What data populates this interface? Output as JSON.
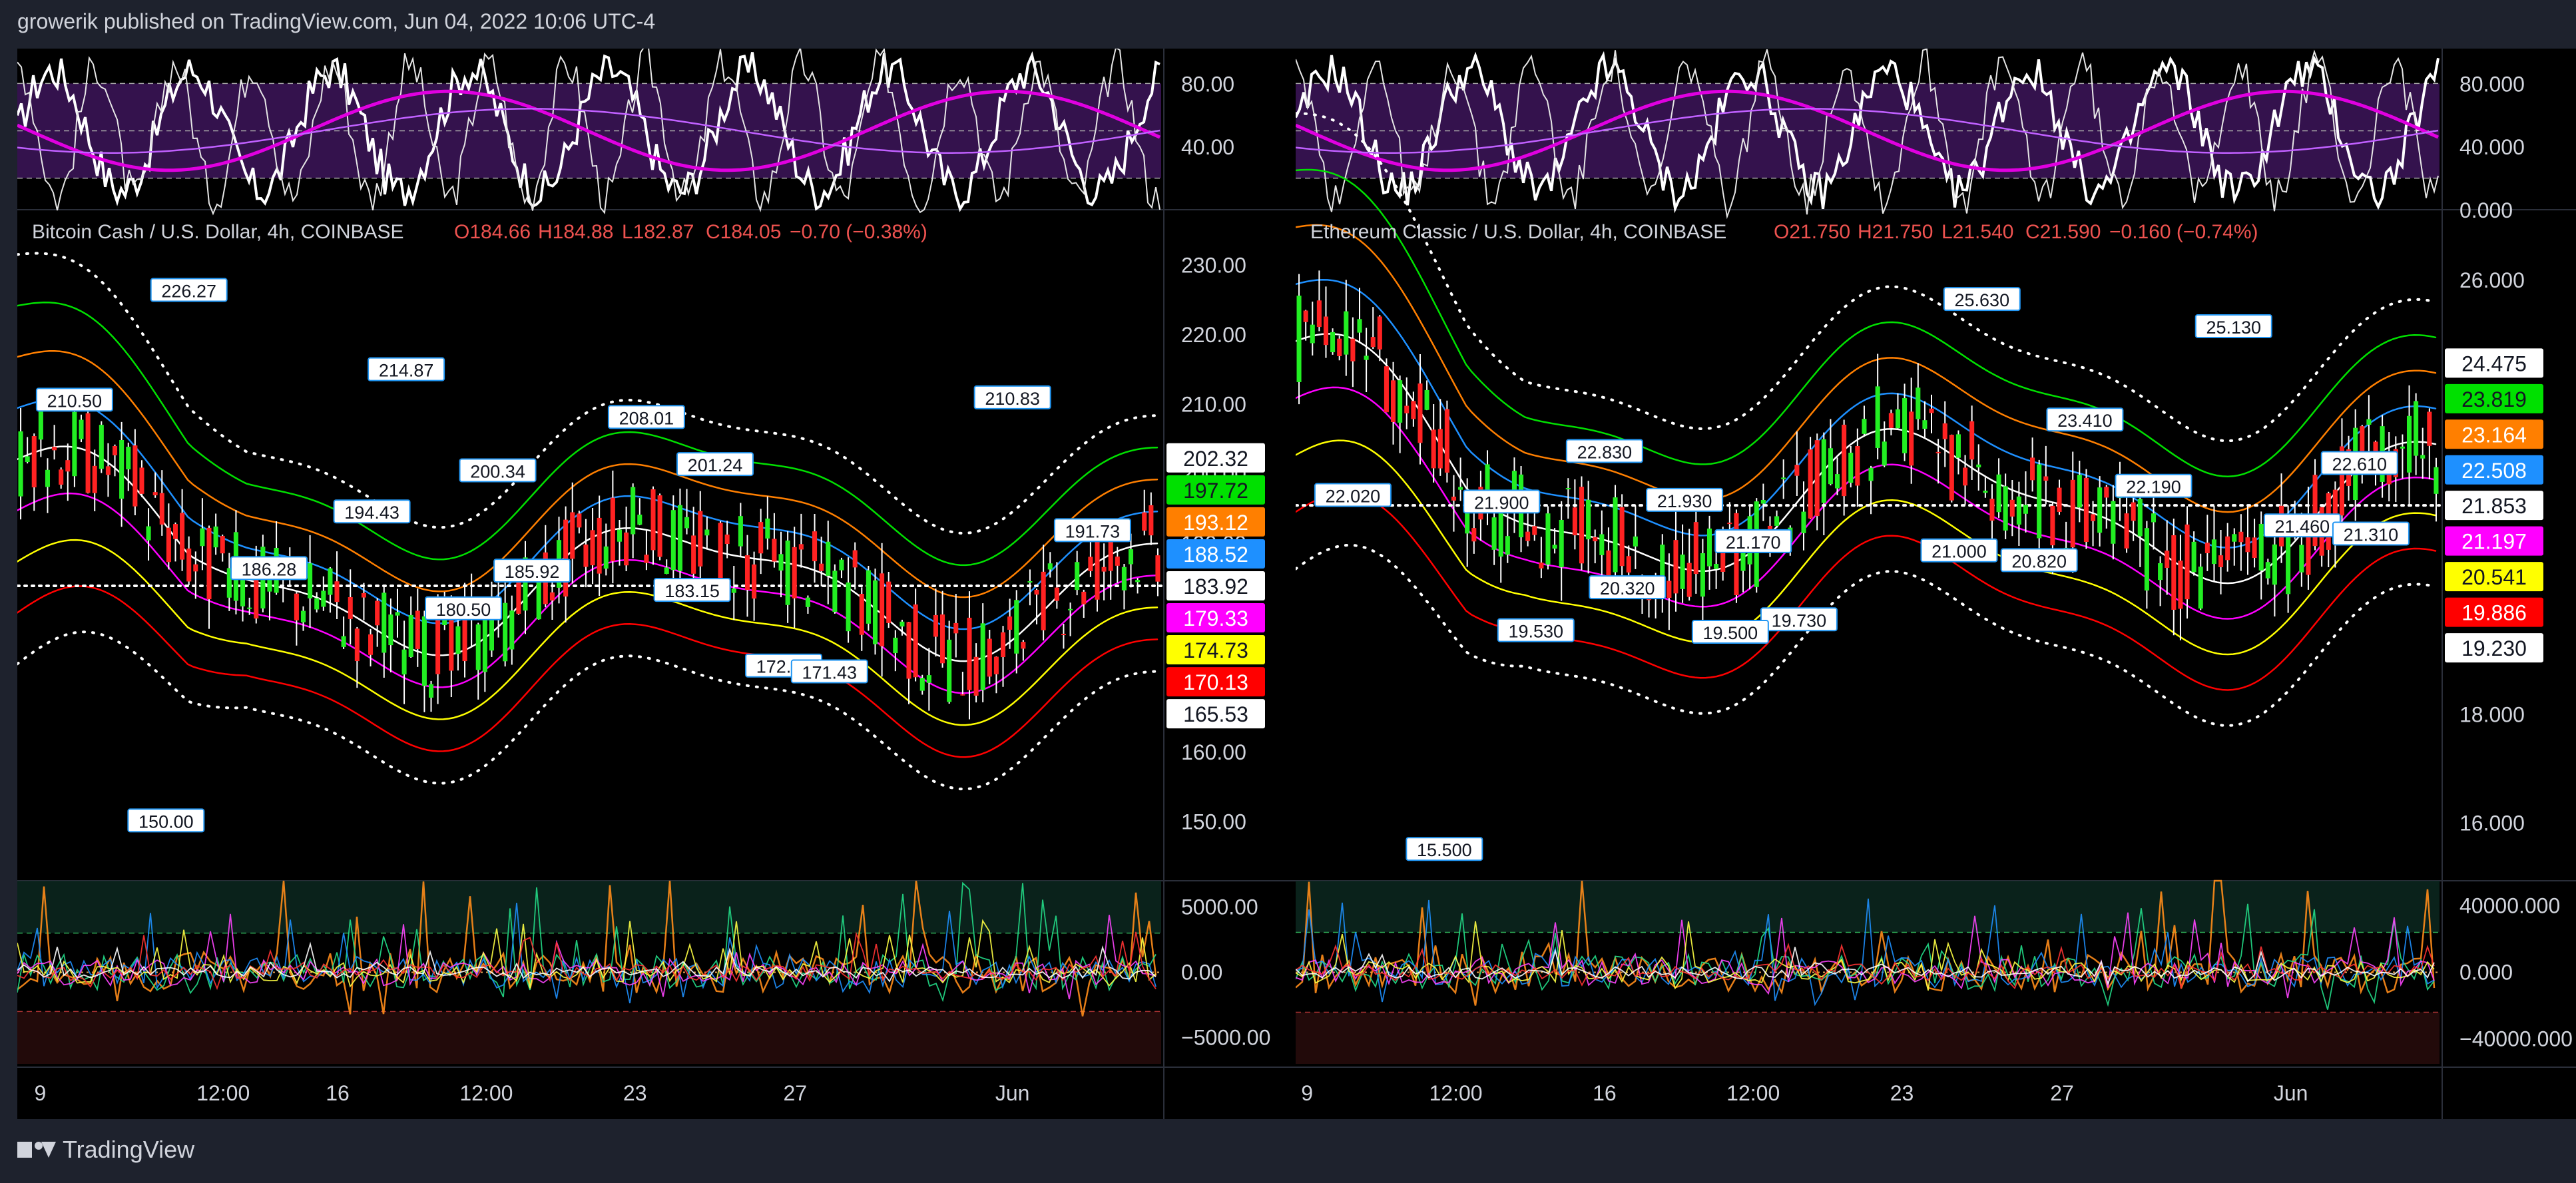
{
  "header": {
    "text": "growerik published on TradingView.com, Jun 04, 2022 10:06 UTC-4"
  },
  "footer": {
    "brand": "TradingView"
  },
  "chart_data": [
    {
      "type": "candlestick",
      "title": "Bitcoin Cash / U.S. Dollar, 4h, COINBASE",
      "ohlc": {
        "o": "O184.66",
        "h": "H184.88",
        "l": "L182.87",
        "c": "C184.05",
        "chg": "−0.70 (−0.38%)"
      },
      "ylim": [
        142,
        238
      ],
      "y_ticks": [
        "230.00",
        "220.00",
        "210.00",
        "200.00",
        "190.00",
        "180.00",
        "170.00",
        "160.00",
        "150.00"
      ],
      "y_tick_values": [
        230,
        220,
        210,
        200,
        190,
        180,
        170,
        160,
        150
      ],
      "x_ticks": [
        "9",
        "12:00",
        "16",
        "12:00",
        "23",
        "27",
        "Jun"
      ],
      "x_tick_pos": [
        0.02,
        0.18,
        0.28,
        0.41,
        0.54,
        0.68,
        0.87
      ],
      "current_price": 183.92,
      "band_labels": [
        {
          "value": 202.32,
          "text": "202.32",
          "color": "#ffffff"
        },
        {
          "value": 197.72,
          "text": "197.72",
          "color": "#00e000"
        },
        {
          "value": 193.12,
          "text": "193.12",
          "color": "#ff7f00"
        },
        {
          "value": 188.52,
          "text": "188.52",
          "color": "#1e90ff"
        },
        {
          "value": 183.92,
          "text": "183.92",
          "color": "#ffffff"
        },
        {
          "value": 179.33,
          "text": "179.33",
          "color": "#ff00ff"
        },
        {
          "value": 174.73,
          "text": "174.73",
          "color": "#ffff00"
        },
        {
          "value": 170.13,
          "text": "170.13",
          "color": "#ff0000"
        },
        {
          "value": 165.53,
          "text": "165.53",
          "color": "#ffffff"
        }
      ],
      "annotations": [
        {
          "text": "226.27",
          "x": 0.15,
          "y": 226.27
        },
        {
          "text": "210.50",
          "x": 0.05,
          "y": 210.5
        },
        {
          "text": "214.87",
          "x": 0.34,
          "y": 214.87
        },
        {
          "text": "208.01",
          "x": 0.55,
          "y": 208.01
        },
        {
          "text": "210.83",
          "x": 0.87,
          "y": 210.83
        },
        {
          "text": "200.34",
          "x": 0.42,
          "y": 200.34
        },
        {
          "text": "201.24",
          "x": 0.61,
          "y": 201.24
        },
        {
          "text": "194.43",
          "x": 0.31,
          "y": 194.43
        },
        {
          "text": "191.73",
          "x": 0.94,
          "y": 191.73
        },
        {
          "text": "186.28",
          "x": 0.22,
          "y": 186.28
        },
        {
          "text": "185.92",
          "x": 0.45,
          "y": 185.92
        },
        {
          "text": "183.15",
          "x": 0.59,
          "y": 183.15
        },
        {
          "text": "180.50",
          "x": 0.39,
          "y": 180.5
        },
        {
          "text": "172.27",
          "x": 0.67,
          "y": 172.27
        },
        {
          "text": "171.43",
          "x": 0.71,
          "y": 171.43
        },
        {
          "text": "150.00",
          "x": 0.13,
          "y": 150.0
        }
      ],
      "rsi": {
        "ticks": [
          "80.00",
          "40.00"
        ],
        "tick_values": [
          80,
          40
        ]
      },
      "osc": {
        "ticks": [
          "5000.00",
          "0.00",
          "−5000.00"
        ],
        "tick_values": [
          5000,
          0,
          -5000
        ],
        "ylim": [
          -7000,
          7000
        ]
      }
    },
    {
      "type": "candlestick",
      "title": "Ethereum Classic / U.S. Dollar, 4h, COINBASE",
      "ohlc": {
        "o": "O21.750",
        "h": "H21.750",
        "l": "L21.540",
        "c": "C21.590",
        "chg": "−0.160 (−0.74%)"
      },
      "ylim": [
        15.0,
        27.3
      ],
      "y_ticks": [
        "26.000",
        "18.000",
        "16.000"
      ],
      "y_tick_values": [
        26,
        18,
        16
      ],
      "x_ticks": [
        "9",
        "12:00",
        "16",
        "12:00",
        "23",
        "27",
        "Jun"
      ],
      "x_tick_pos": [
        0.01,
        0.14,
        0.27,
        0.4,
        0.53,
        0.67,
        0.87
      ],
      "current_price": 21.853,
      "band_labels": [
        {
          "value": 24.475,
          "text": "24.475",
          "color": "#ffffff"
        },
        {
          "value": 23.819,
          "text": "23.819",
          "color": "#00e000"
        },
        {
          "value": 23.164,
          "text": "23.164",
          "color": "#ff7f00"
        },
        {
          "value": 22.508,
          "text": "22.508",
          "color": "#1e90ff"
        },
        {
          "value": 21.853,
          "text": "21.853",
          "color": "#ffffff"
        },
        {
          "value": 21.197,
          "text": "21.197",
          "color": "#ff00ff"
        },
        {
          "value": 20.541,
          "text": "20.541",
          "color": "#ffff00"
        },
        {
          "value": 19.886,
          "text": "19.886",
          "color": "#ff0000"
        },
        {
          "value": 19.23,
          "text": "19.230",
          "color": "#ffffff"
        }
      ],
      "annotations": [
        {
          "text": "25.630",
          "x": 0.6,
          "y": 25.63
        },
        {
          "text": "25.130",
          "x": 0.82,
          "y": 25.13
        },
        {
          "text": "23.410",
          "x": 0.69,
          "y": 23.41
        },
        {
          "text": "22.830",
          "x": 0.27,
          "y": 22.83
        },
        {
          "text": "22.610",
          "x": 0.93,
          "y": 22.61
        },
        {
          "text": "21.930",
          "x": 0.34,
          "y": 21.93
        },
        {
          "text": "21.900",
          "x": 0.18,
          "y": 21.9
        },
        {
          "text": "22.020",
          "x": 0.05,
          "y": 22.02
        },
        {
          "text": "22.190",
          "x": 0.75,
          "y": 22.19
        },
        {
          "text": "21.170",
          "x": 0.4,
          "y": 21.17
        },
        {
          "text": "21.000",
          "x": 0.58,
          "y": 21.0
        },
        {
          "text": "21.460",
          "x": 0.88,
          "y": 21.46
        },
        {
          "text": "21.310",
          "x": 0.94,
          "y": 21.31
        },
        {
          "text": "20.820",
          "x": 0.65,
          "y": 20.82
        },
        {
          "text": "20.320",
          "x": 0.29,
          "y": 20.32
        },
        {
          "text": "19.730",
          "x": 0.44,
          "y": 19.73
        },
        {
          "text": "19.530",
          "x": 0.21,
          "y": 19.53
        },
        {
          "text": "19.500",
          "x": 0.38,
          "y": 19.5
        },
        {
          "text": "15.500",
          "x": 0.13,
          "y": 15.5
        }
      ],
      "rsi": {
        "ticks": [
          "80.000",
          "40.000",
          "0.000"
        ],
        "tick_values": [
          80,
          40,
          0
        ]
      },
      "osc": {
        "ticks": [
          "40000.000",
          "0.000",
          "−40000.000"
        ],
        "tick_values": [
          40000,
          0,
          -40000
        ],
        "ylim": [
          -55000,
          55000
        ]
      }
    }
  ]
}
